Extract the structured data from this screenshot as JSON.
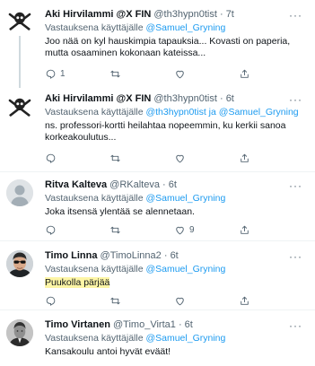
{
  "tweets": [
    {
      "name": "Aki Hirvilammi @X FIN",
      "handle": "@th3hypn0tist",
      "dot": "·",
      "time": "7t",
      "reply_prefix": "Vastauksena käyttäjälle",
      "mentions": "@Samuel_Gryning",
      "mentions_joiner": "",
      "mention2": "",
      "text": "Joo nää on kyl hauskimpia tapauksia... Kovasti on paperia, mutta osaaminen kokonaan kateissa...",
      "reply_count": "1",
      "retweet_count": "",
      "like_count": "",
      "avatar": "pirate-flag-icon"
    },
    {
      "name": "Aki Hirvilammi @X FIN",
      "handle": "@th3hypn0tist",
      "dot": "·",
      "time": "6t",
      "reply_prefix": "Vastauksena käyttäjälle",
      "mentions": "@th3hypn0tist",
      "mentions_joiner": "ja",
      "mention2": "@Samuel_Gryning",
      "text": "ns. professori-kortti heilahtaa nopeemmin, ku kerkii sanoa korkeakoulutus...",
      "reply_count": "",
      "retweet_count": "",
      "like_count": "",
      "avatar": "pirate-flag-icon"
    },
    {
      "name": "Ritva Kalteva",
      "handle": "@RKalteva",
      "dot": "·",
      "time": "6t",
      "reply_prefix": "Vastauksena käyttäjälle",
      "mentions": "@Samuel_Gryning",
      "mentions_joiner": "",
      "mention2": "",
      "text": "Joka itsensä ylentää se alennetaan.",
      "reply_count": "",
      "retweet_count": "",
      "like_count": "9",
      "avatar": "default-profile-icon"
    },
    {
      "name": "Timo Linna",
      "handle": "@TimoLinna2",
      "dot": "·",
      "time": "6t",
      "reply_prefix": "Vastauksena käyttäjälle",
      "mentions": "@Samuel_Gryning",
      "mentions_joiner": "",
      "mention2": "",
      "text": "Puukolla pärjää",
      "reply_count": "",
      "retweet_count": "",
      "like_count": "",
      "avatar": "sunglasses-man-photo"
    },
    {
      "name": "Timo Virtanen",
      "handle": "@Timo_Virta1",
      "dot": "·",
      "time": "6t",
      "reply_prefix": "Vastauksena käyttäjälle",
      "mentions": "@Samuel_Gryning",
      "mentions_joiner": "",
      "mention2": "",
      "text": "Kansakoulu antoi hyvät eväät!",
      "reply_count": "",
      "retweet_count": "",
      "like_count": "",
      "avatar": "bw-portrait-photo"
    }
  ],
  "more_label": "···",
  "colors": {
    "link": "#1d9bf0",
    "secondary": "#536471",
    "highlight": "#fdf5a6",
    "divider": "#eff3f4"
  }
}
